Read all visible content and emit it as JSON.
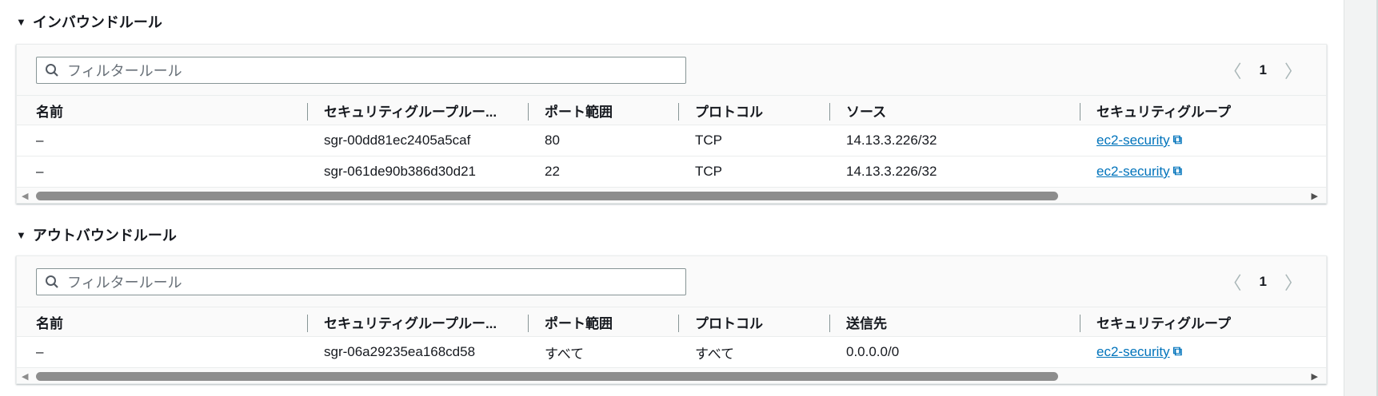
{
  "inbound": {
    "title": "インバウンドルール",
    "filter_placeholder": "フィルタールール",
    "page": "1",
    "columns": [
      "名前",
      "セキュリティグループルー...",
      "ポート範囲",
      "プロトコル",
      "ソース",
      "セキュリティグループ"
    ],
    "rows": [
      {
        "name": "–",
        "rule_id": "sgr-00dd81ec2405a5caf",
        "port": "80",
        "protocol": "TCP",
        "source": "14.13.3.226/32",
        "sg": "ec2-security"
      },
      {
        "name": "–",
        "rule_id": "sgr-061de90b386d30d21",
        "port": "22",
        "protocol": "TCP",
        "source": "14.13.3.226/32",
        "sg": "ec2-security"
      }
    ]
  },
  "outbound": {
    "title": "アウトバウンドルール",
    "filter_placeholder": "フィルタールール",
    "page": "1",
    "columns": [
      "名前",
      "セキュリティグループルー...",
      "ポート範囲",
      "プロトコル",
      "送信先",
      "セキュリティグループ"
    ],
    "rows": [
      {
        "name": "–",
        "rule_id": "sgr-06a29235ea168cd58",
        "port": "すべて",
        "protocol": "すべて",
        "source": "0.0.0.0/0",
        "sg": "ec2-security"
      }
    ]
  }
}
